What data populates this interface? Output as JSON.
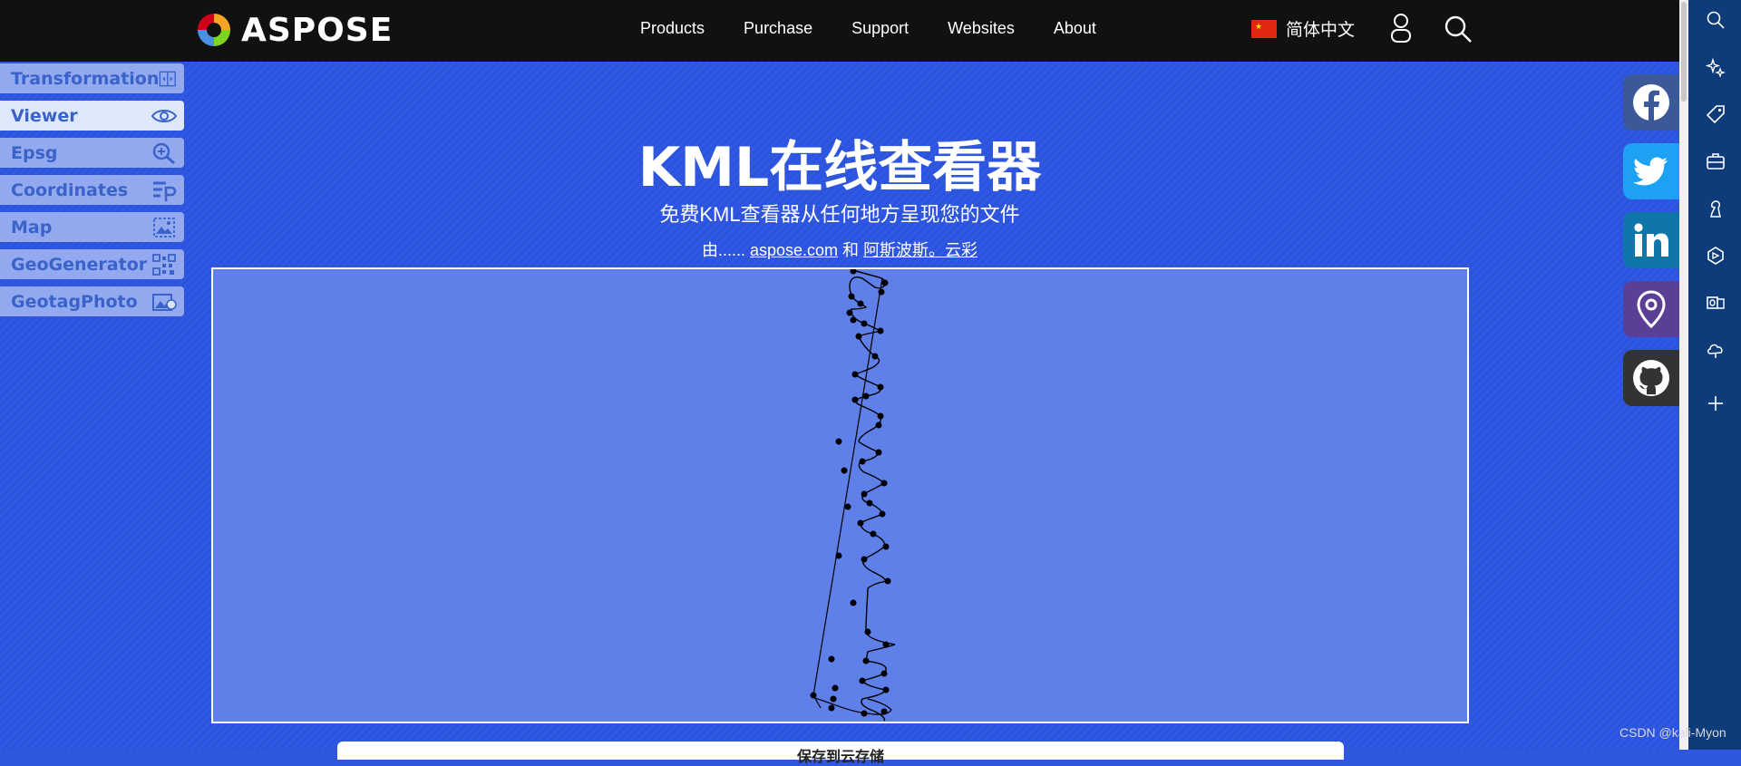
{
  "brand": {
    "logo_text": "ASPOSE"
  },
  "nav": {
    "items": [
      "Products",
      "Purchase",
      "Support",
      "Websites",
      "About"
    ],
    "language": "简体中文"
  },
  "tools": [
    {
      "label": "Transformation",
      "icon": "transformation-icon"
    },
    {
      "label": "Viewer",
      "icon": "eye-icon",
      "active": true
    },
    {
      "label": "Epsg",
      "icon": "epsg-search-icon"
    },
    {
      "label": "Coordinates",
      "icon": "coordinates-icon"
    },
    {
      "label": "Map",
      "icon": "map-image-icon"
    },
    {
      "label": "GeoGenerator",
      "icon": "qr-grid-icon"
    },
    {
      "label": "GeotagPhoto",
      "icon": "photo-tag-icon"
    }
  ],
  "hero": {
    "title": "KML在线查看器",
    "subtitle": "免费KML查看器从任何地方呈现您的文件",
    "by_prefix": "由......",
    "link1": "aspose.com",
    "and": "和",
    "link2": "阿斯波斯。云彩"
  },
  "bottom_button": "保存到云存储",
  "social": [
    "facebook-icon",
    "twitter-icon",
    "linkedin-icon",
    "location-pin-icon",
    "github-icon"
  ],
  "social_colors": [
    "#3b5998",
    "#1da1f2",
    "#0e76a8",
    "#5b3f96",
    "#333333"
  ],
  "edge_sidebar": [
    "search-icon",
    "sparkle-icon",
    "tag-icon",
    "toolbox-icon",
    "chess-icon",
    "copilot-icon",
    "outlook-icon",
    "cloud-bell-icon",
    "add-icon"
  ],
  "watermark": "CSDN @kali-Myon"
}
